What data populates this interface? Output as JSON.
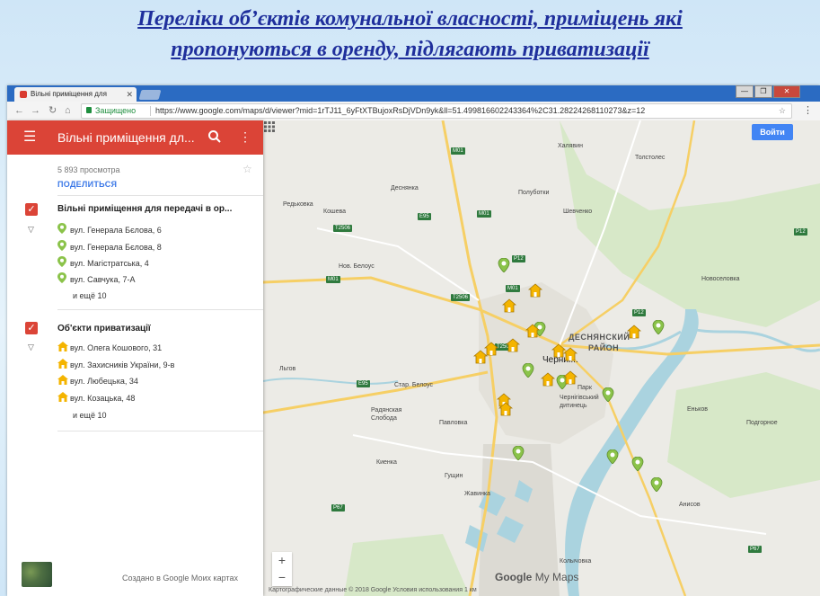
{
  "slide": {
    "title_line1": "Переліки об’єктів комунальної власності, приміщень які",
    "title_line2": "пропонуються  в оренду, підлягають приватизації"
  },
  "browser": {
    "tab_label": "Вільні приміщення для",
    "tab_close": "✕",
    "secure_label": "Защищено",
    "url": "https://www.google.com/maps/d/viewer?mid=1rTJ11_6yFtXTBujoxRsDjVDn9yk&ll=51.499816602243364%2C31.28224268110273&z=12",
    "win_min": "—",
    "win_max": "❐",
    "win_close": "✕"
  },
  "panel": {
    "title": "Вільні приміщення дл...",
    "views": "5 893 просмотра",
    "share": "ПОДЕЛИТЬСЯ",
    "layers": [
      {
        "title": "Вільні приміщення для передачі в ор...",
        "items": [
          "вул. Генерала Бєлова, 6",
          "вул. Генерала Бєлова, 8",
          "вул. Магістратська, 4",
          "вул. Савчука, 7-А"
        ],
        "more": "и ещё 10",
        "icon": "green-pin-icon"
      },
      {
        "title": "Об'єкти приватизації",
        "items": [
          "вул. Олега Кошового, 31",
          "вул. Захисників України, 9-в",
          "вул. Любецька, 34",
          "вул. Козацька, 48"
        ],
        "more": "и ещё 10",
        "icon": "yellow-house-icon"
      }
    ],
    "footer_credit": "Создано в Google Моих картах"
  },
  "map": {
    "login": "Войти",
    "brand_google": "Google",
    "brand_mymaps": "My Maps",
    "footer": "Картографические данные © 2018 Google    Условия использования    1 км",
    "zoom_in": "+",
    "zoom_out": "−",
    "places": {
      "khalyavyn": "Халявин",
      "tolstoles": "Толстолес",
      "desnyanka": "Деснянка",
      "polubotky": "Полуботки",
      "redkivka": "Редьковка",
      "koshevo": "Кошева",
      "shevchenko": "Шевченко",
      "nov_belous": "Нов. Белоус",
      "novoselovka": "Новоселовка",
      "desnyanskyi": "ДЕСНЯНСКИЙ",
      "raion": "РАЙОН",
      "chernihiv": "Черниг...",
      "lgov": "Льгов",
      "star_belous": "Стар. Белоус",
      "park": "Парк",
      "dytynets": "Чернігівський дитинець",
      "radyanska": "Радянская Слобода",
      "pavlovka": "Павловка",
      "enkovo": "Еньков",
      "podgornoe": "Подгорное",
      "kienka": "Киенка",
      "gushchyn": "Гущин",
      "zhavinka": "Жавинка",
      "anisov": "Анисов",
      "kolychivka": "Колычовка"
    },
    "roads": {
      "m01a": "M01",
      "m01b": "M01",
      "m01c": "M01",
      "m01d": "M01",
      "p12a": "P12",
      "p12b": "P12",
      "p12c": "P12",
      "t2506a": "T2506",
      "t2506b": "T2506",
      "t2506c": "T2506",
      "e95a": "E95",
      "e95b": "E95",
      "p67a": "P67",
      "p67b": "P67"
    }
  }
}
